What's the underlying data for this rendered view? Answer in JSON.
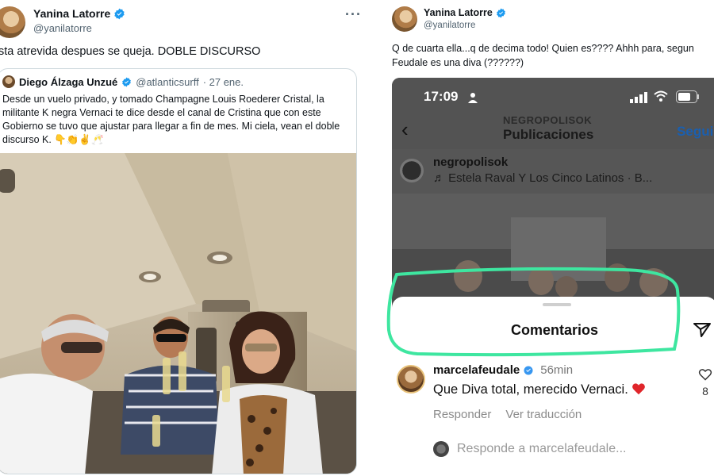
{
  "left": {
    "author": {
      "name": "Yanina Latorre",
      "handle": "@yanilatorre"
    },
    "more_label": "···",
    "text": "sta atrevida despues se queja. DOBLE DISCURSO",
    "quote": {
      "name": "Diego Álzaga Unzué",
      "handle": "@atlanticsurff",
      "date": "· 27 ene.",
      "text": "Desde un vuelo privado, y tomado Champagne Louis Roederer Cristal, la militante K negra Vernaci te dice desde el canal de Cristina que con este Gobierno se tuvo que ajustar para llegar a fin de mes. Mi ciela, vean el doble discurso K. 👇👏✌️🥂"
    }
  },
  "right": {
    "author": {
      "name": "Yanina Latorre",
      "handle": "@yanilatorre"
    },
    "text": "Q de cuarta ella...q de decima todo! Quien es???? Ahhh para, segun Feudale es una diva (??????)",
    "instagram": {
      "time": "17:09",
      "account": "NEGROPOLISOK",
      "title": "Publicaciones",
      "follow": "Seguir",
      "back_icon": "‹",
      "post_user": "negropolisok",
      "post_song": "♬ Estela Raval Y Los Cinco Latinos · B...",
      "sheet_title": "Comentarios",
      "comment": {
        "user": "marcelafeudale",
        "time": "56min",
        "text": "Que Diva total, merecido Vernaci.",
        "reply": "Responder",
        "translate": "Ver traducción",
        "likes": "8"
      },
      "reply_placeholder": "Responde a marcelafeudale..."
    }
  },
  "colors": {
    "verified": "#1d9bf0",
    "highlight": "#3ee6a0",
    "link_blue": "#1a5fb0",
    "heart": "#e0262b"
  }
}
